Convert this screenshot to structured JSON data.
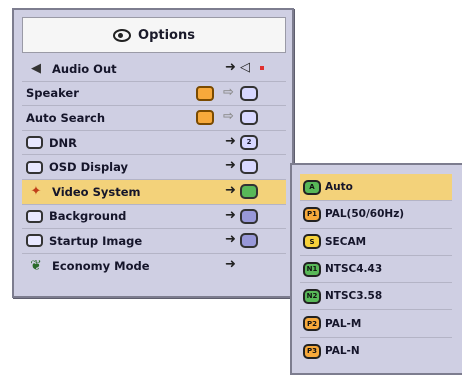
{
  "main_menu": {
    "title": "Options",
    "items": [
      {
        "label": "Audio Out",
        "icon": "speaker-icon",
        "control": "arrow-speaker"
      },
      {
        "label": "Speaker",
        "icon": "",
        "control": "toggle"
      },
      {
        "label": "Auto Search",
        "icon": "",
        "control": "toggle"
      },
      {
        "label": "DNR",
        "icon": "dnr-icon",
        "control": "arrow-box",
        "mini": "2"
      },
      {
        "label": "OSD Display",
        "icon": "osd-icon",
        "control": "arrow-box"
      },
      {
        "label": "Video System",
        "icon": "video-system-icon",
        "control": "arrow-box",
        "selected": true
      },
      {
        "label": "Background",
        "icon": "background-icon",
        "control": "arrow-box"
      },
      {
        "label": "Startup Image",
        "icon": "startup-image-icon",
        "control": "arrow-box"
      },
      {
        "label": "Economy Mode",
        "icon": "economy-mode-icon",
        "control": "arrow"
      }
    ]
  },
  "video_system_submenu": {
    "items": [
      {
        "badge": "A",
        "label": "Auto",
        "badge_color": "#58b858",
        "selected": true
      },
      {
        "badge": "P1",
        "label": "PAL(50/60Hz)",
        "badge_color": "#f7a93b"
      },
      {
        "badge": "S",
        "label": "SECAM",
        "badge_color": "#f7d23b"
      },
      {
        "badge": "N1",
        "label": "NTSC4.43",
        "badge_color": "#58b858"
      },
      {
        "badge": "N2",
        "label": "NTSC3.58",
        "badge_color": "#58b858"
      },
      {
        "badge": "P2",
        "label": "PAL-M",
        "badge_color": "#f7a93b"
      },
      {
        "badge": "P3",
        "label": "PAL-N",
        "badge_color": "#f7a93b"
      }
    ]
  },
  "colors": {
    "panel_bg": "#cfcfe3",
    "selected_bg": "#f3d27a",
    "toggle_orange": "#f7a93b"
  }
}
